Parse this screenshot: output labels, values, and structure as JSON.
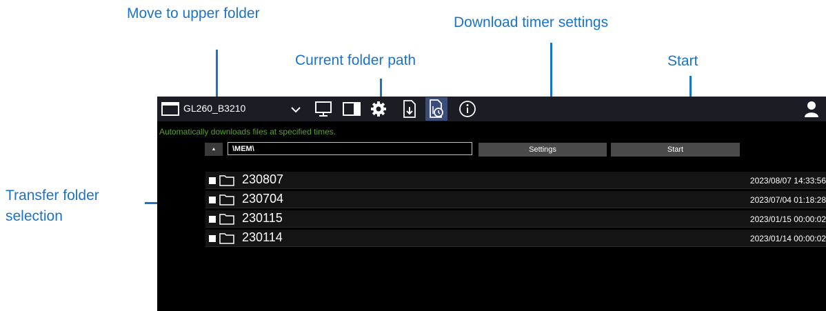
{
  "callouts": {
    "move_up": "Move to upper folder",
    "download_timer": "Download timer settings",
    "current_path": "Current folder path",
    "start": "Start",
    "transfer_selection_line1": "Transfer folder",
    "transfer_selection_line2": "selection"
  },
  "topbar": {
    "device_name": "GL260_B3210",
    "icons": [
      "window-icon",
      "chevron-down-icon",
      "monitor-icon",
      "window-icon",
      "gear-icon",
      "file-download-icon",
      "file-timer-icon",
      "info-icon",
      "user-icon"
    ]
  },
  "hint": "Automatically downloads files at specified times.",
  "path": {
    "up_button": "▲",
    "value": "\\MEM\\"
  },
  "buttons": {
    "settings": "Settings",
    "start": "Start"
  },
  "folders": [
    {
      "name": "230807",
      "date": "2023/08/07 14:33:56"
    },
    {
      "name": "230704",
      "date": "2023/07/04 01:18:28"
    },
    {
      "name": "230115",
      "date": "2023/01/15 00:00:02"
    },
    {
      "name": "230114",
      "date": "2023/01/14 00:00:02"
    }
  ],
  "colors": {
    "callout": "#1a73c8",
    "hint_text": "#5aa02c",
    "screen_bg": "#000000",
    "topbar_bg": "#1c1c24",
    "active_icon_bg": "#3a4d7a"
  }
}
